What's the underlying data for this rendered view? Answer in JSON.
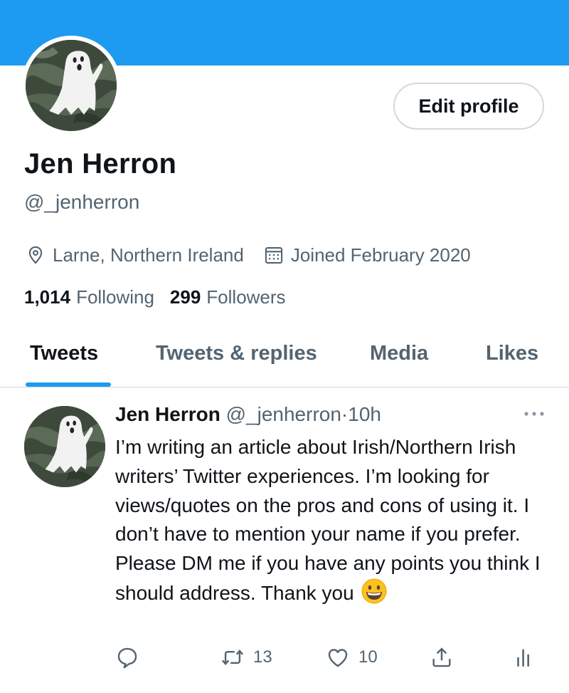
{
  "colors": {
    "accent": "#1d9bf0",
    "text": "#0f1419",
    "secondary": "#536471",
    "border": "#cfd9de"
  },
  "profile": {
    "display_name": "Jen Herron",
    "handle": "@_jenherron",
    "location": "Larne, Northern Ireland",
    "joined": "Joined February 2020",
    "following_count": "1,014",
    "following_label": "Following",
    "followers_count": "299",
    "followers_label": "Followers",
    "edit_button_label": "Edit profile",
    "avatar_icon": "ghost-avatar"
  },
  "tabs": [
    {
      "label": "Tweets",
      "active": true
    },
    {
      "label": "Tweets & replies",
      "active": false
    },
    {
      "label": "Media",
      "active": false
    },
    {
      "label": "Likes",
      "active": false
    }
  ],
  "tweet": {
    "author_name": "Jen Herron",
    "author_handle": "@_jenherron",
    "separator": "·",
    "time": "10h",
    "text": "I’m writing an article about Irish/Northern Irish writers’ Twitter experiences. I’m looking for views/quotes on the pros and cons of using it. I don’t have to mention your name if you prefer. Please DM me if you have any points you think I should address. Thank you",
    "emoji": "grinning-face",
    "retweets": "13",
    "likes": "10"
  }
}
